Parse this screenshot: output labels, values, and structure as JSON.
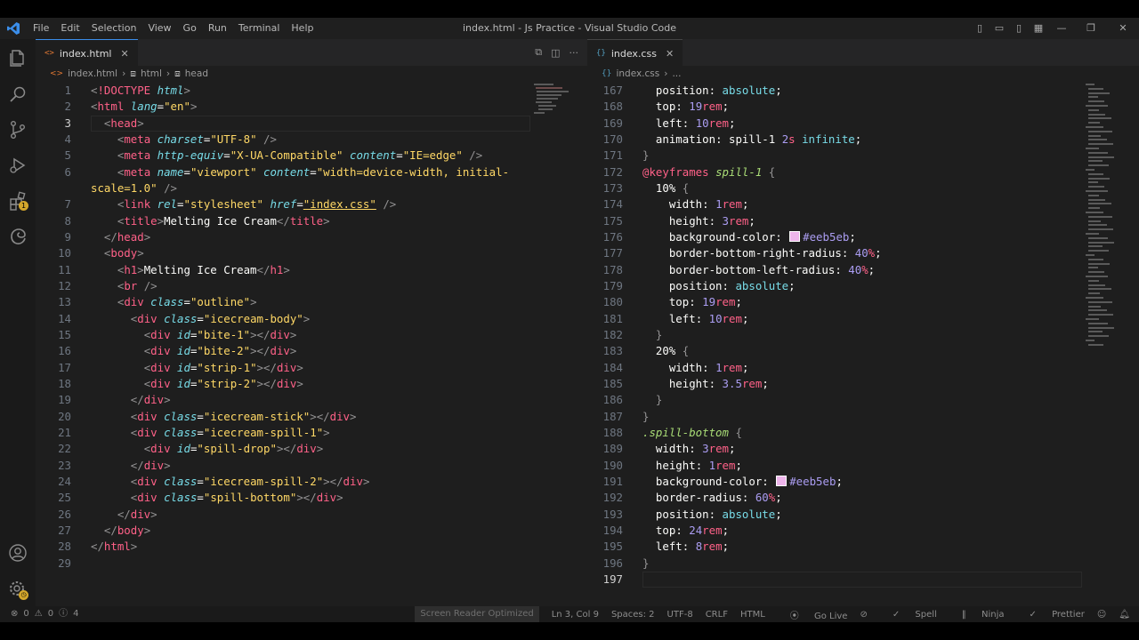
{
  "window": {
    "title": "index.html - Js Practice - Visual Studio Code"
  },
  "menu": [
    "File",
    "Edit",
    "Selection",
    "View",
    "Go",
    "Run",
    "Terminal",
    "Help"
  ],
  "activity_badge": "1",
  "left_editor": {
    "tab_label": "index.html",
    "tab_icon": "<>",
    "breadcrumb": [
      "index.html",
      "html",
      "head"
    ],
    "current_line": 3
  },
  "right_editor": {
    "tab_label": "index.css",
    "tab_icon": "{}",
    "breadcrumb": [
      "index.css",
      "..."
    ],
    "current_line": 197
  },
  "html_lines": [
    {
      "n": "1",
      "h": "<span class='p'>&lt;</span><span class='t'>!DOCTYPE</span> <span class='a'>html</span><span class='p'>&gt;</span>"
    },
    {
      "n": "2",
      "h": "<span class='p'>&lt;</span><span class='t'>html</span> <span class='a'>lang</span><span class='c'>=</span><span class='s'>\"en\"</span><span class='p'>&gt;</span>"
    },
    {
      "n": "3",
      "h": "  <span class='p'>&lt;</span><span class='t'>head</span><span class='p'>&gt;</span>"
    },
    {
      "n": "4",
      "h": "    <span class='p'>&lt;</span><span class='t'>meta</span> <span class='a'>charset</span><span class='c'>=</span><span class='s'>\"UTF-8\"</span> <span class='p'>/&gt;</span>"
    },
    {
      "n": "5",
      "h": "    <span class='p'>&lt;</span><span class='t'>meta</span> <span class='a'>http-equiv</span><span class='c'>=</span><span class='s'>\"X-UA-Compatible\"</span> <span class='a'>content</span><span class='c'>=</span><span class='s'>\"IE=edge\"</span> <span class='p'>/&gt;</span>"
    },
    {
      "n": "6",
      "h": "    <span class='p'>&lt;</span><span class='t'>meta</span> <span class='a'>name</span><span class='c'>=</span><span class='s'>\"viewport\"</span> <span class='a'>content</span><span class='c'>=</span><span class='s'>\"width=device-width, initial-</span>"
    },
    {
      "n": "",
      "h": "<span class='s'>scale=1.0\"</span> <span class='p'>/&gt;</span>"
    },
    {
      "n": "7",
      "h": "    <span class='p'>&lt;</span><span class='t'>link</span> <span class='a'>rel</span><span class='c'>=</span><span class='s'>\"stylesheet\"</span> <span class='a'>href</span><span class='c'>=</span><span class='s' style='text-decoration:underline'>\"index.css\"</span> <span class='p'>/&gt;</span>"
    },
    {
      "n": "8",
      "h": "    <span class='p'>&lt;</span><span class='t'>title</span><span class='p'>&gt;</span><span class='c'>Melting Ice Cream</span><span class='p'>&lt;/</span><span class='t'>title</span><span class='p'>&gt;</span>"
    },
    {
      "n": "9",
      "h": "  <span class='p'>&lt;/</span><span class='t'>head</span><span class='p'>&gt;</span>"
    },
    {
      "n": "10",
      "h": "  <span class='p'>&lt;</span><span class='t'>body</span><span class='p'>&gt;</span>"
    },
    {
      "n": "11",
      "h": "    <span class='p'>&lt;</span><span class='t'>h1</span><span class='p'>&gt;</span><span class='c'>Melting Ice Cream</span><span class='p'>&lt;/</span><span class='t'>h1</span><span class='p'>&gt;</span>"
    },
    {
      "n": "12",
      "h": "    <span class='p'>&lt;</span><span class='t'>br</span> <span class='p'>/&gt;</span>"
    },
    {
      "n": "13",
      "h": "    <span class='p'>&lt;</span><span class='t'>div</span> <span class='a'>class</span><span class='c'>=</span><span class='s'>\"outline\"</span><span class='p'>&gt;</span>"
    },
    {
      "n": "14",
      "h": "      <span class='p'>&lt;</span><span class='t'>div</span> <span class='a'>class</span><span class='c'>=</span><span class='s'>\"icecream-body\"</span><span class='p'>&gt;</span>"
    },
    {
      "n": "15",
      "h": "        <span class='p'>&lt;</span><span class='t'>div</span> <span class='a'>id</span><span class='c'>=</span><span class='s'>\"bite-1\"</span><span class='p'>&gt;&lt;/</span><span class='t'>div</span><span class='p'>&gt;</span>"
    },
    {
      "n": "16",
      "h": "        <span class='p'>&lt;</span><span class='t'>div</span> <span class='a'>id</span><span class='c'>=</span><span class='s'>\"bite-2\"</span><span class='p'>&gt;&lt;/</span><span class='t'>div</span><span class='p'>&gt;</span>"
    },
    {
      "n": "17",
      "h": "        <span class='p'>&lt;</span><span class='t'>div</span> <span class='a'>id</span><span class='c'>=</span><span class='s'>\"strip-1\"</span><span class='p'>&gt;&lt;/</span><span class='t'>div</span><span class='p'>&gt;</span>"
    },
    {
      "n": "18",
      "h": "        <span class='p'>&lt;</span><span class='t'>div</span> <span class='a'>id</span><span class='c'>=</span><span class='s'>\"strip-2\"</span><span class='p'>&gt;&lt;/</span><span class='t'>div</span><span class='p'>&gt;</span>"
    },
    {
      "n": "19",
      "h": "      <span class='p'>&lt;/</span><span class='t'>div</span><span class='p'>&gt;</span>"
    },
    {
      "n": "20",
      "h": "      <span class='p'>&lt;</span><span class='t'>div</span> <span class='a'>class</span><span class='c'>=</span><span class='s'>\"icecream-stick\"</span><span class='p'>&gt;&lt;/</span><span class='t'>div</span><span class='p'>&gt;</span>"
    },
    {
      "n": "21",
      "h": "      <span class='p'>&lt;</span><span class='t'>div</span> <span class='a'>class</span><span class='c'>=</span><span class='s'>\"icecream-spill-1\"</span><span class='p'>&gt;</span>"
    },
    {
      "n": "22",
      "h": "        <span class='p'>&lt;</span><span class='t'>div</span> <span class='a'>id</span><span class='c'>=</span><span class='s'>\"spill-drop\"</span><span class='p'>&gt;&lt;/</span><span class='t'>div</span><span class='p'>&gt;</span>"
    },
    {
      "n": "23",
      "h": "      <span class='p'>&lt;/</span><span class='t'>div</span><span class='p'>&gt;</span>"
    },
    {
      "n": "24",
      "h": "      <span class='p'>&lt;</span><span class='t'>div</span> <span class='a'>class</span><span class='c'>=</span><span class='s'>\"icecream-spill-2\"</span><span class='p'>&gt;&lt;/</span><span class='t'>div</span><span class='p'>&gt;</span>"
    },
    {
      "n": "25",
      "h": "      <span class='p'>&lt;</span><span class='t'>div</span> <span class='a'>class</span><span class='c'>=</span><span class='s'>\"spill-bottom\"</span><span class='p'>&gt;&lt;/</span><span class='t'>div</span><span class='p'>&gt;</span>"
    },
    {
      "n": "26",
      "h": "    <span class='p'>&lt;/</span><span class='t'>div</span><span class='p'>&gt;</span>"
    },
    {
      "n": "27",
      "h": "  <span class='p'>&lt;/</span><span class='t'>body</span><span class='p'>&gt;</span>"
    },
    {
      "n": "28",
      "h": "<span class='p'>&lt;/</span><span class='t'>html</span><span class='p'>&gt;</span>"
    },
    {
      "n": "29",
      "h": ""
    }
  ],
  "css_lines": [
    {
      "n": "167",
      "h": "  <span class='pr'>position</span><span class='c'>:</span> <span class='a' style='font-style:normal'>absolute</span><span class='c'>;</span>"
    },
    {
      "n": "168",
      "h": "  <span class='pr'>top</span><span class='c'>:</span> <span class='n'>19</span><span class='u'>rem</span><span class='c'>;</span>"
    },
    {
      "n": "169",
      "h": "  <span class='pr'>left</span><span class='c'>:</span> <span class='n'>10</span><span class='u'>rem</span><span class='c'>;</span>"
    },
    {
      "n": "170",
      "h": "  <span class='pr'>animation</span><span class='c'>:</span> <span class='c'>spill-1</span> <span class='n'>2</span><span class='u'>s</span> <span class='a' style='font-style:normal'>infinite</span><span class='c'>;</span>"
    },
    {
      "n": "171",
      "h": "<span class='p'>}</span>"
    },
    {
      "n": "172",
      "h": "<span class='kw'>@keyframes</span> <span class='sel'>spill-1</span> <span class='p'>{</span>"
    },
    {
      "n": "173",
      "h": "  <span class='c'>10%</span> <span class='p'>{</span>"
    },
    {
      "n": "174",
      "h": "    <span class='pr'>width</span><span class='c'>:</span> <span class='n'>1</span><span class='u'>rem</span><span class='c'>;</span>"
    },
    {
      "n": "175",
      "h": "    <span class='pr'>height</span><span class='c'>:</span> <span class='n'>3</span><span class='u'>rem</span><span class='c'>;</span>"
    },
    {
      "n": "176",
      "h": "    <span class='pr'>background-color</span><span class='c'>:</span> <span class='swatch'></span><span class='n'>#eeb5eb</span><span class='c'>;</span>"
    },
    {
      "n": "177",
      "h": "    <span class='pr'>border-bottom-right-radius</span><span class='c'>:</span> <span class='n'>40</span><span class='u'>%</span><span class='c'>;</span>"
    },
    {
      "n": "178",
      "h": "    <span class='pr'>border-bottom-left-radius</span><span class='c'>:</span> <span class='n'>40</span><span class='u'>%</span><span class='c'>;</span>"
    },
    {
      "n": "179",
      "h": "    <span class='pr'>position</span><span class='c'>:</span> <span class='a' style='font-style:normal'>absolute</span><span class='c'>;</span>"
    },
    {
      "n": "180",
      "h": "    <span class='pr'>top</span><span class='c'>:</span> <span class='n'>19</span><span class='u'>rem</span><span class='c'>;</span>"
    },
    {
      "n": "181",
      "h": "    <span class='pr'>left</span><span class='c'>:</span> <span class='n'>10</span><span class='u'>rem</span><span class='c'>;</span>"
    },
    {
      "n": "182",
      "h": "  <span class='p'>}</span>"
    },
    {
      "n": "183",
      "h": "  <span class='c'>20%</span> <span class='p'>{</span>"
    },
    {
      "n": "184",
      "h": "    <span class='pr'>width</span><span class='c'>:</span> <span class='n'>1</span><span class='u'>rem</span><span class='c'>;</span>"
    },
    {
      "n": "185",
      "h": "    <span class='pr'>height</span><span class='c'>:</span> <span class='n'>3.5</span><span class='u'>rem</span><span class='c'>;</span>"
    },
    {
      "n": "186",
      "h": "  <span class='p'>}</span>"
    },
    {
      "n": "187",
      "h": "<span class='p'>}</span>"
    },
    {
      "n": "188",
      "h": "<span class='sel'>.spill-bottom</span> <span class='p'>{</span>"
    },
    {
      "n": "189",
      "h": "  <span class='pr'>width</span><span class='c'>:</span> <span class='n'>3</span><span class='u'>rem</span><span class='c'>;</span>"
    },
    {
      "n": "190",
      "h": "  <span class='pr'>height</span><span class='c'>:</span> <span class='n'>1</span><span class='u'>rem</span><span class='c'>;</span>"
    },
    {
      "n": "191",
      "h": "  <span class='pr'>background-color</span><span class='c'>:</span> <span class='swatch'></span><span class='n'>#eeb5eb</span><span class='c'>;</span>"
    },
    {
      "n": "192",
      "h": "  <span class='pr'>border-radius</span><span class='c'>:</span> <span class='n'>60</span><span class='u'>%</span><span class='c'>;</span>"
    },
    {
      "n": "193",
      "h": "  <span class='pr'>position</span><span class='c'>:</span> <span class='a' style='font-style:normal'>absolute</span><span class='c'>;</span>"
    },
    {
      "n": "194",
      "h": "  <span class='pr'>top</span><span class='c'>:</span> <span class='n'>24</span><span class='u'>rem</span><span class='c'>;</span>"
    },
    {
      "n": "195",
      "h": "  <span class='pr'>left</span><span class='c'>:</span> <span class='n'>8</span><span class='u'>rem</span><span class='c'>;</span>"
    },
    {
      "n": "196",
      "h": "<span class='p'>}</span>"
    },
    {
      "n": "197",
      "h": ""
    }
  ],
  "status": {
    "errors": "0",
    "warnings": "0",
    "info": "4",
    "screen_reader": "Screen Reader Optimized",
    "position": "Ln 3, Col 9",
    "spaces": "Spaces: 2",
    "encoding": "UTF-8",
    "eol": "CRLF",
    "language": "HTML",
    "golive": "Go Live",
    "spell": "Spell",
    "ninja": "Ninja",
    "prettier": "Prettier"
  },
  "colors": {
    "accent": "#3b8eea",
    "swatch": "#eeb5eb",
    "background": "#1e1e1e"
  }
}
